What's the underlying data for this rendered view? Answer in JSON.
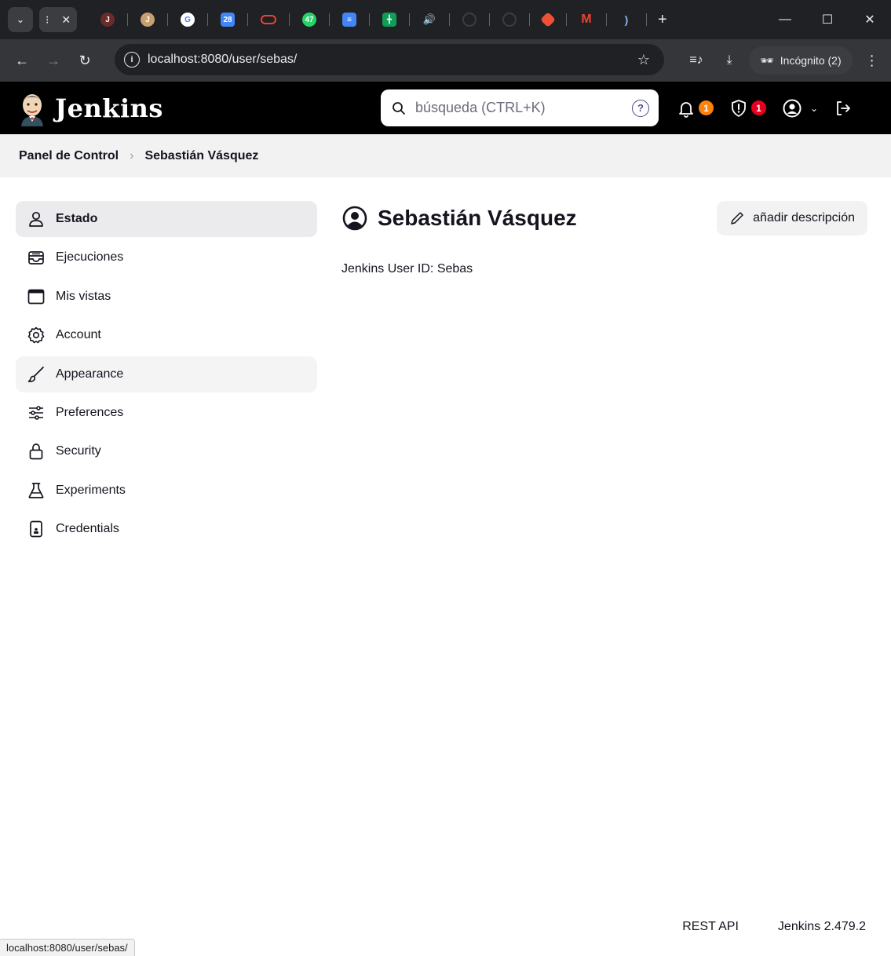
{
  "browser": {
    "url": "localhost:8080/user/sebas/",
    "incognito_label": "Incógnito (2)",
    "status_url": "localhost:8080/user/sebas/",
    "calendar_favicon_text": "28",
    "whatsapp_favicon_text": "47"
  },
  "header": {
    "brand": "Jenkins",
    "search_placeholder": "búsqueda (CTRL+K)",
    "help_glyph": "?",
    "notifications_count": "1",
    "security_count": "1"
  },
  "breadcrumb": {
    "items": [
      "Panel de Control",
      "Sebastián Vásquez"
    ]
  },
  "sidebar": {
    "items": [
      {
        "label": "Estado",
        "icon": "person-icon"
      },
      {
        "label": "Ejecuciones",
        "icon": "builds-icon"
      },
      {
        "label": "Mis vistas",
        "icon": "window-icon"
      },
      {
        "label": "Account",
        "icon": "gear-icon"
      },
      {
        "label": "Appearance",
        "icon": "brush-icon"
      },
      {
        "label": "Preferences",
        "icon": "sliders-icon"
      },
      {
        "label": "Security",
        "icon": "lock-icon"
      },
      {
        "label": "Experiments",
        "icon": "flask-icon"
      },
      {
        "label": "Credentials",
        "icon": "credentials-icon"
      }
    ]
  },
  "main": {
    "title": "Sebastián Vásquez",
    "add_description": "añadir descripción",
    "user_id_text": "Jenkins User ID: Sebas"
  },
  "footer": {
    "rest_api": "REST API",
    "version": "Jenkins 2.479.2"
  },
  "colors": {
    "header_bg": "#000000",
    "badge_notifications": "#fe820a",
    "badge_security": "#e6001f",
    "sidebar_active": "#ebebed"
  }
}
